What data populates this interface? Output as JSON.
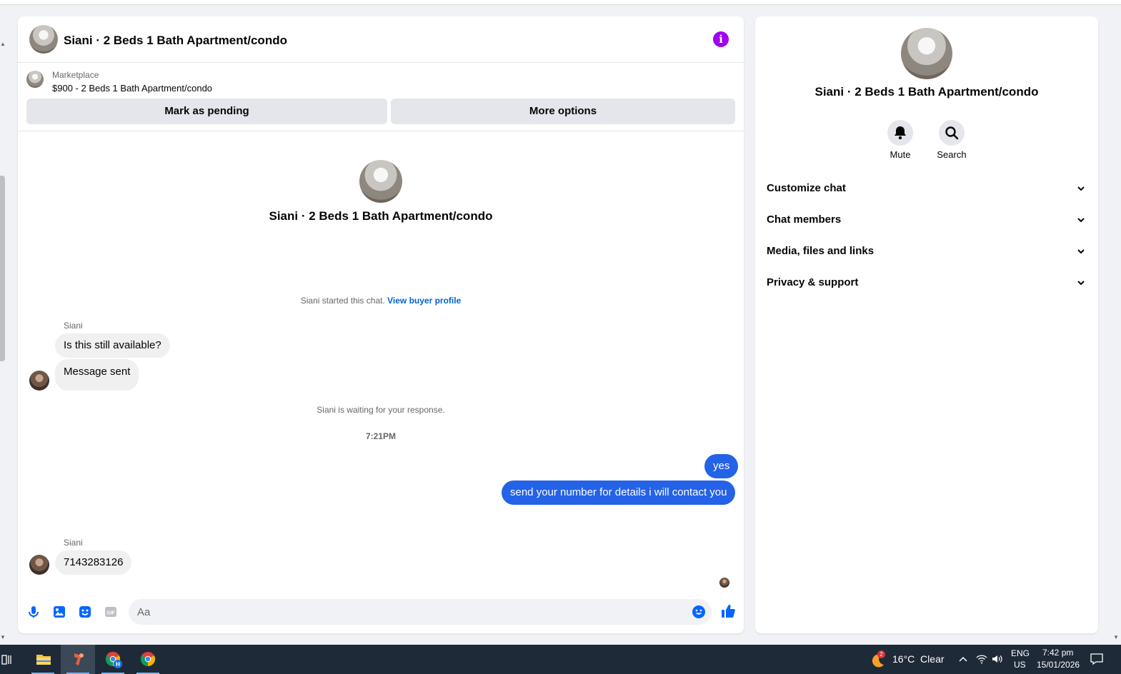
{
  "chat": {
    "title": "Siani · 2 Beds 1 Bath Apartment/condo",
    "marketplace_label": "Marketplace",
    "listing_line": "$900 - 2 Beds 1 Bath Apartment/condo",
    "mark_pending_label": "Mark as pending",
    "more_options_label": "More options",
    "profile_name": "Siani · 2 Beds 1 Bath Apartment/condo",
    "started_text": "Siani started this chat.",
    "view_buyer_profile": "View buyer profile",
    "messages": [
      {
        "sender": "Siani",
        "text": "Is this still available?"
      },
      {
        "text": "Message sent"
      }
    ],
    "waiting_text": "Siani is waiting for your response.",
    "timestamp": "7:21PM",
    "outgoing": [
      "yes",
      "send your number for details i will contact you"
    ],
    "reply_sender": "Siani",
    "reply_text": "7143283126",
    "composer_placeholder": "Aa",
    "accent": "#0866ff",
    "outgoing_color": "#2462e8"
  },
  "sidebar": {
    "title": "Siani · 2 Beds 1 Bath Apartment/condo",
    "mute_label": "Mute",
    "search_label": "Search",
    "sections": [
      "Customize chat",
      "Chat members",
      "Media, files and links",
      "Privacy & support"
    ]
  },
  "taskbar": {
    "weather_badge": "2",
    "weather": "16°C  Clear",
    "lang_top": "ENG",
    "lang_bottom": "US",
    "time": "7:42 pm",
    "date": "15/01/2026",
    "apps": [
      "file-explorer-icon",
      "app-icon",
      "chrome-profile-h-icon",
      "chrome-icon"
    ]
  }
}
